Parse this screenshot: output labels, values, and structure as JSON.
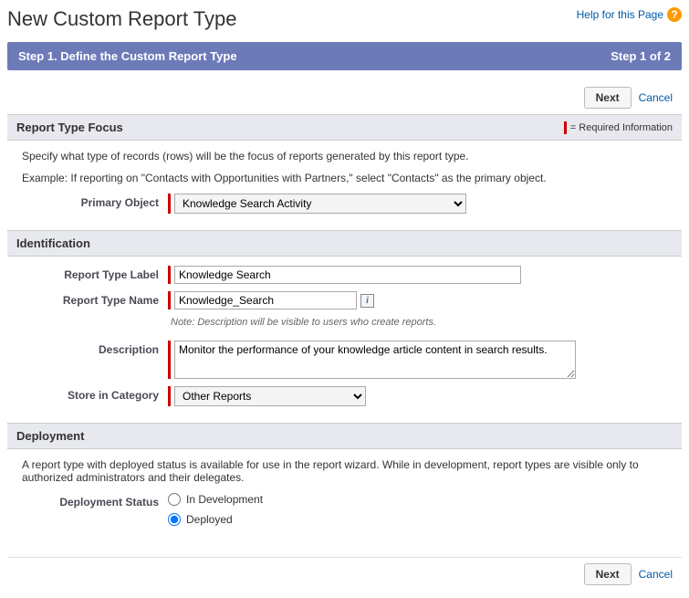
{
  "header": {
    "title": "New Custom Report Type",
    "help": "Help for this Page"
  },
  "step": {
    "left": "Step 1. Define the Custom Report Type",
    "right": "Step 1 of 2"
  },
  "buttons": {
    "next": "Next",
    "cancel": "Cancel"
  },
  "focus": {
    "title": "Report Type Focus",
    "required_note": "= Required Information",
    "desc1": "Specify what type of records (rows) will be the focus of reports generated by this report type.",
    "desc2": "Example: If reporting on \"Contacts with Opportunities with Partners,\" select \"Contacts\" as the primary object.",
    "primary_label": "Primary Object",
    "primary_value": "Knowledge Search Activity"
  },
  "ident": {
    "title": "Identification",
    "label_label": "Report Type Label",
    "label_value": "Knowledge Search",
    "name_label": "Report Type Name",
    "name_value": "Knowledge_Search",
    "note": "Note: Description will be visible to users who create reports.",
    "desc_label": "Description",
    "desc_value": "Monitor the performance of your knowledge article content in search results.",
    "store_label": "Store in Category",
    "store_value": "Other Reports"
  },
  "deploy": {
    "title": "Deployment",
    "desc": "A report type with deployed status is available for use in the report wizard. While in development, report types are visible only to authorized administrators and their delegates.",
    "status_label": "Deployment Status",
    "options": {
      "dev": "In Development",
      "deployed": "Deployed"
    },
    "selected": "deployed"
  }
}
